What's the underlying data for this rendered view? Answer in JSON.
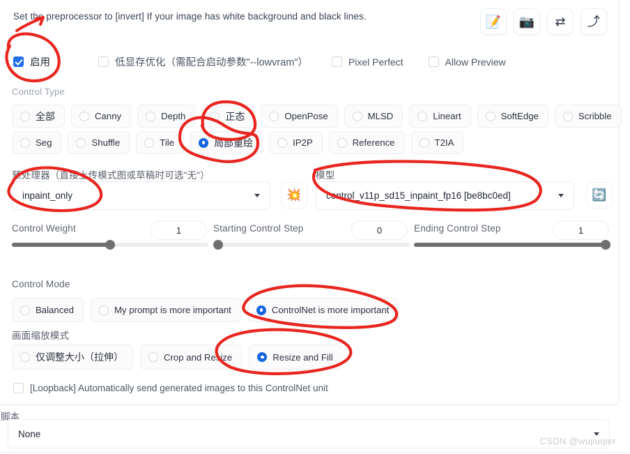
{
  "hint": {
    "text": "Set the preprocessor to [invert] If your image has white background and black lines."
  },
  "toolbar": {
    "icons": [
      {
        "name": "edit-note-icon",
        "glyph": "📝"
      },
      {
        "name": "camera-icon",
        "glyph": "📷"
      },
      {
        "name": "swap-icon",
        "glyph": "⇄"
      },
      {
        "name": "upload-arrow-icon",
        "glyph": "⤴"
      }
    ]
  },
  "checkboxes": [
    {
      "label": "启用",
      "checked": true
    },
    {
      "label": "低显存优化（需配合启动参数\"--lowvram\"）",
      "checked": false
    },
    {
      "label": "Pixel Perfect",
      "checked": false
    },
    {
      "label": "Allow Preview",
      "checked": false
    }
  ],
  "control_type": {
    "label": "Control Type",
    "row1": [
      {
        "label": "全部",
        "selected": false
      },
      {
        "label": "Canny",
        "selected": false
      },
      {
        "label": "Depth",
        "selected": false
      },
      {
        "label": "正态",
        "selected": false
      },
      {
        "label": "OpenPose",
        "selected": false
      },
      {
        "label": "MLSD",
        "selected": false
      },
      {
        "label": "Lineart",
        "selected": false
      },
      {
        "label": "SoftEdge",
        "selected": false
      },
      {
        "label": "Scribble",
        "selected": false
      }
    ],
    "row2": [
      {
        "label": "Seg",
        "selected": false
      },
      {
        "label": "Shuffle",
        "selected": false
      },
      {
        "label": "Tile",
        "selected": false
      },
      {
        "label": "局部重绘",
        "selected": true
      },
      {
        "label": "IP2P",
        "selected": false
      },
      {
        "label": "Reference",
        "selected": false
      },
      {
        "label": "T2IA",
        "selected": false
      }
    ]
  },
  "preprocessor": {
    "label": "预处理器（直接上传模式图或草稿时可选\"无\"）",
    "value": "inpaint_only"
  },
  "explode_button": {
    "name": "explosion-icon",
    "glyph": "💥"
  },
  "model": {
    "label": "模型",
    "value": "control_v11p_sd15_inpaint_fp16 [be8bc0ed]"
  },
  "refresh_button": {
    "name": "refresh-icon",
    "glyph": "🔄"
  },
  "sliders": [
    {
      "label": "Control Weight",
      "value": "1",
      "percent": 50
    },
    {
      "label": "Starting Control Step",
      "value": "0",
      "percent": 0
    },
    {
      "label": "Ending Control Step",
      "value": "1",
      "percent": 100
    }
  ],
  "control_mode": {
    "label": "Control Mode",
    "options": [
      {
        "label": "Balanced",
        "selected": false
      },
      {
        "label": "My prompt is more important",
        "selected": false
      },
      {
        "label": "ControlNet is more important",
        "selected": true
      }
    ]
  },
  "resize_mode": {
    "label": "画面缩放模式",
    "options": [
      {
        "label": "仅调整大小（拉伸）",
        "selected": false
      },
      {
        "label": "Crop and Resize",
        "selected": false
      },
      {
        "label": "Resize and Fill",
        "selected": true
      }
    ]
  },
  "loopback": {
    "label": "[Loopback] Automatically send generated images to this ControlNet unit",
    "checked": false
  },
  "script": {
    "label": "脚本",
    "value": "None"
  },
  "watermark": {
    "text": "CSDN @wujiuqier"
  },
  "colors": {
    "accent": "#1565e0",
    "checkbox_accent": "#1f6feb",
    "annotation": "#e8251f",
    "slider": "#6f6f6f"
  }
}
